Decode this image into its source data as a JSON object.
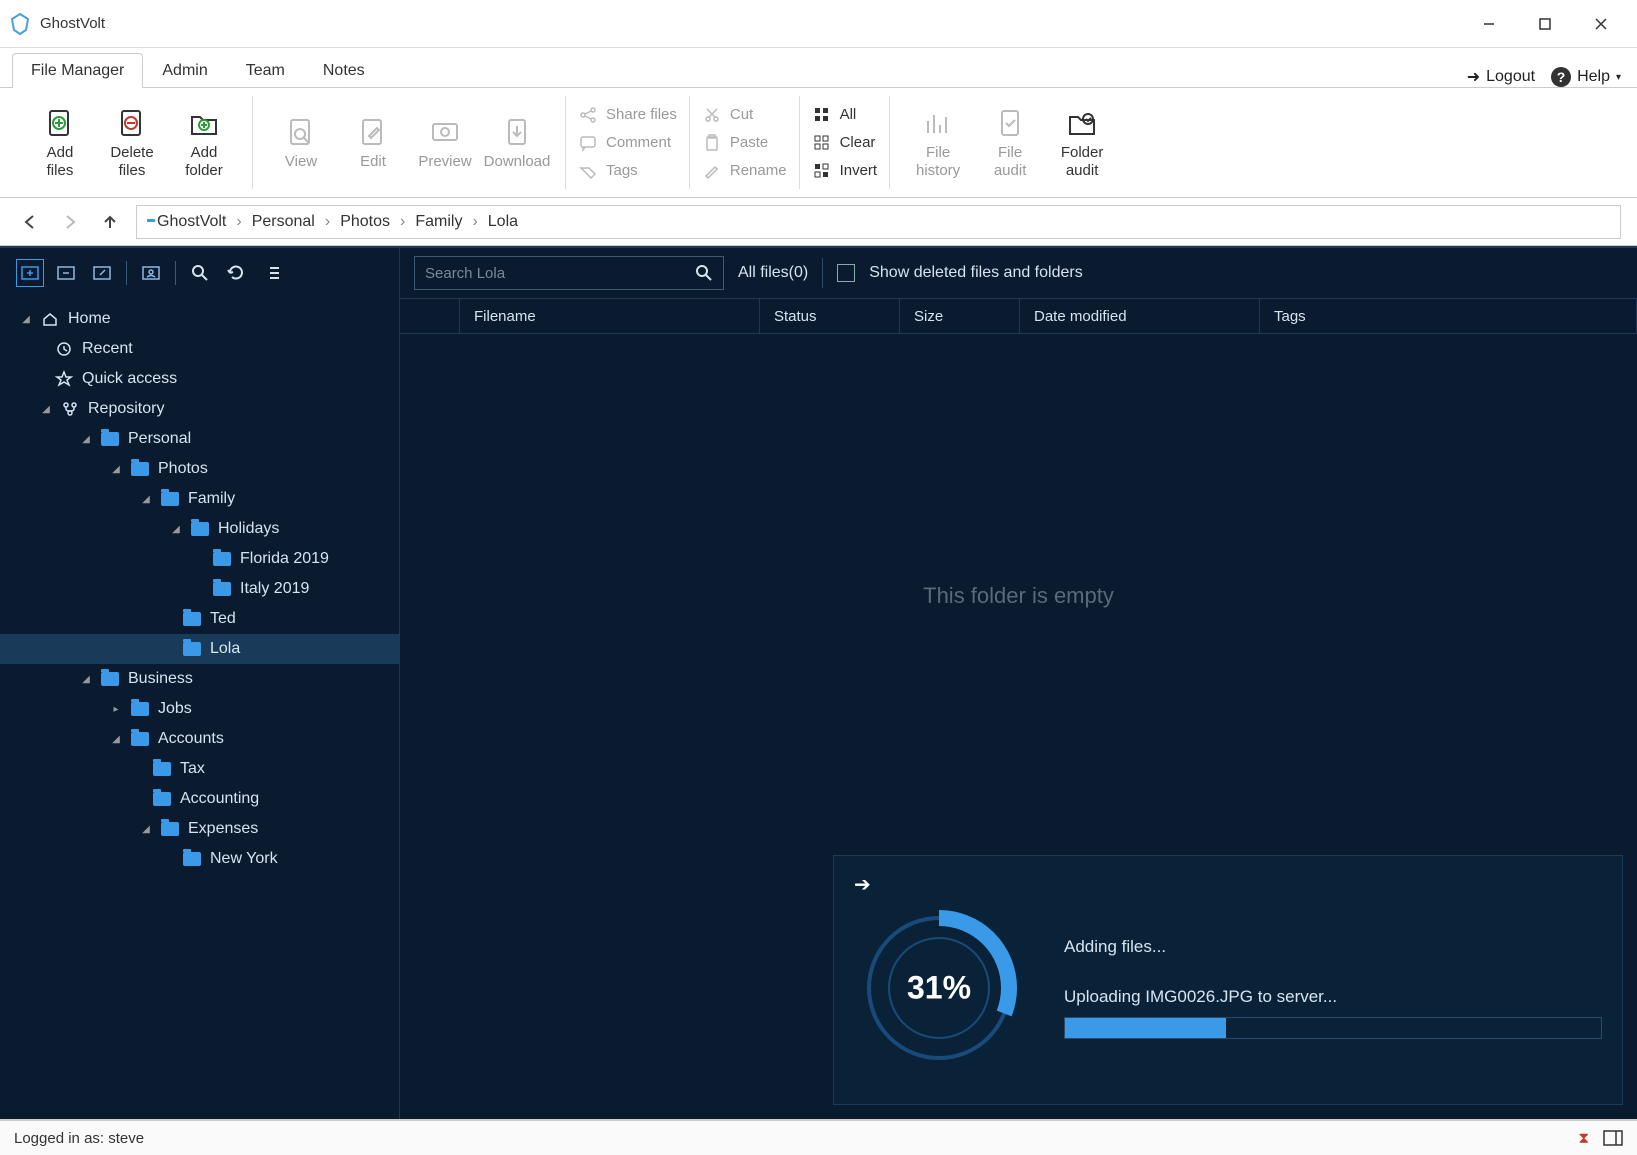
{
  "app": {
    "title": "GhostVolt"
  },
  "window": {
    "min": "–",
    "max": "☐",
    "close": "✕"
  },
  "menu": {
    "tabs": [
      "File Manager",
      "Admin",
      "Team",
      "Notes"
    ],
    "active": 0,
    "logout": "Logout",
    "help": "Help"
  },
  "ribbon": {
    "add_files": "Add\nfiles",
    "delete_files": "Delete\nfiles",
    "add_folder": "Add\nfolder",
    "view": "View",
    "edit": "Edit",
    "preview": "Preview",
    "download": "Download",
    "share": "Share files",
    "comment": "Comment",
    "tags": "Tags",
    "cut": "Cut",
    "paste": "Paste",
    "rename": "Rename",
    "all": "All",
    "clear": "Clear",
    "invert": "Invert",
    "file_history": "File\nhistory",
    "file_audit": "File\naudit",
    "folder_audit": "Folder\naudit"
  },
  "breadcrumb": {
    "items": [
      "GhostVolt",
      "Personal",
      "Photos",
      "Family",
      "Lola"
    ]
  },
  "sidebar": {
    "search_placeholder": "Search Lola",
    "tree": {
      "home": "Home",
      "recent": "Recent",
      "quick": "Quick access",
      "repo": "Repository",
      "personal": "Personal",
      "photos": "Photos",
      "family": "Family",
      "holidays": "Holidays",
      "florida": "Florida 2019",
      "italy": "Italy 2019",
      "ted": "Ted",
      "lola": "Lola",
      "business": "Business",
      "jobs": "Jobs",
      "accounts": "Accounts",
      "tax": "Tax",
      "accounting": "Accounting",
      "expenses": "Expenses",
      "newyork": "New York"
    }
  },
  "filelist": {
    "all_files": "All files(0)",
    "show_deleted": "Show deleted files and folders",
    "columns": {
      "filename": "Filename",
      "status": "Status",
      "size": "Size",
      "date": "Date modified",
      "tags": "Tags"
    },
    "empty": "This folder is empty"
  },
  "progress": {
    "percent": 31,
    "percent_label": "31%",
    "title": "Adding files...",
    "detail": "Uploading IMG0026.JPG to  server...",
    "bar_percent": 30
  },
  "status": {
    "user": "Logged in as: steve"
  }
}
